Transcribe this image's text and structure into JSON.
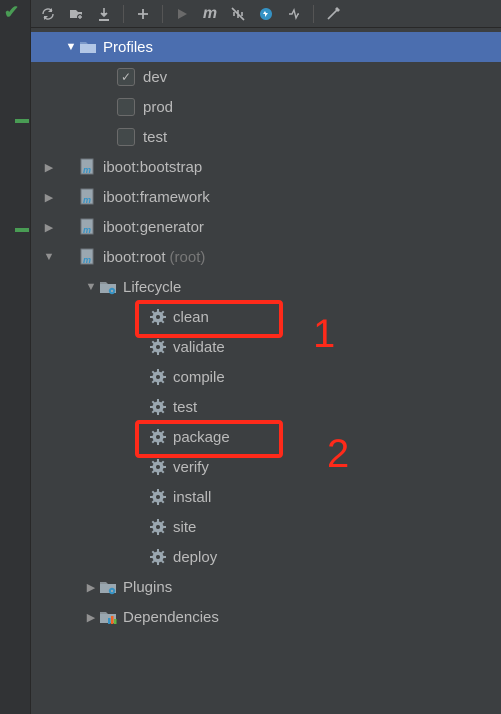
{
  "profiles": {
    "header": "Profiles",
    "items": [
      {
        "label": "dev",
        "checked": true
      },
      {
        "label": "prod",
        "checked": false
      },
      {
        "label": "test",
        "checked": false
      }
    ]
  },
  "modules": [
    {
      "label": "iboot:bootstrap",
      "expanded": false
    },
    {
      "label": "iboot:framework",
      "expanded": false
    },
    {
      "label": "iboot:generator",
      "expanded": false
    }
  ],
  "rootModule": {
    "label": "iboot:root",
    "suffix": "(root)",
    "lifecycle": {
      "label": "Lifecycle",
      "goals": [
        "clean",
        "validate",
        "compile",
        "test",
        "package",
        "verify",
        "install",
        "site",
        "deploy"
      ]
    },
    "plugins": {
      "label": "Plugins"
    },
    "dependencies": {
      "label": "Dependencies"
    }
  },
  "annotations": {
    "box1_goal": "clean",
    "box2_goal": "package",
    "label1": "1",
    "label2": "2"
  }
}
